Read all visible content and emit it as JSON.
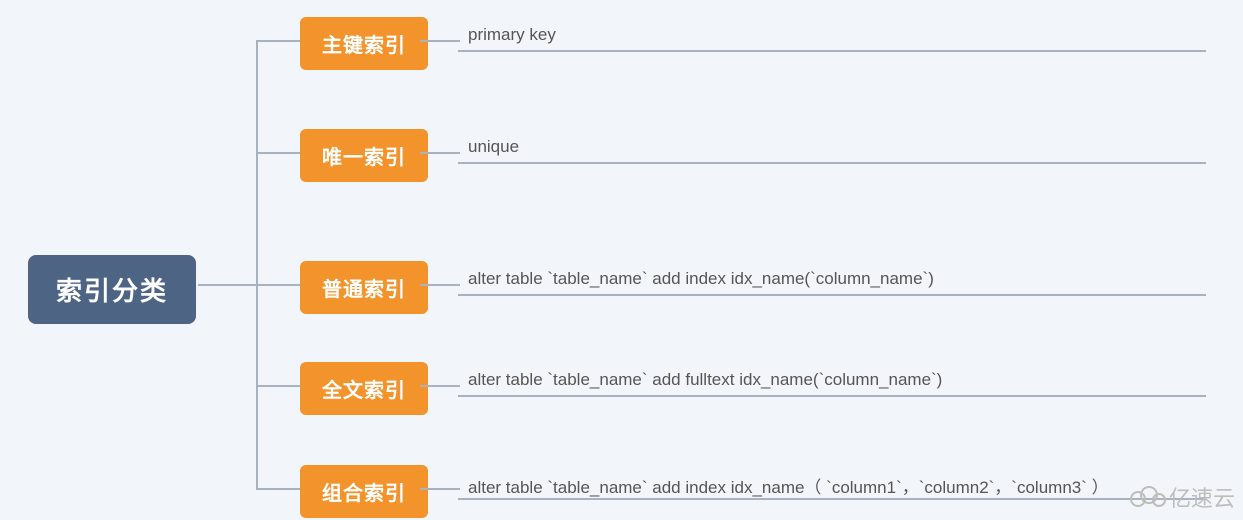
{
  "root": {
    "label": "索引分类"
  },
  "children": [
    {
      "label": "主键索引",
      "desc": "primary key"
    },
    {
      "label": "唯一索引",
      "desc": "unique"
    },
    {
      "label": "普通索引",
      "desc": "alter table `table_name` add index idx_name(`column_name`)"
    },
    {
      "label": "全文索引",
      "desc": "alter table `table_name` add fulltext idx_name(`column_name`)"
    },
    {
      "label": "组合索引",
      "desc": "alter table  `table_name`  add index idx_name（ `column1`，`column2`，`column3` ）"
    }
  ],
  "watermark": "亿速云"
}
